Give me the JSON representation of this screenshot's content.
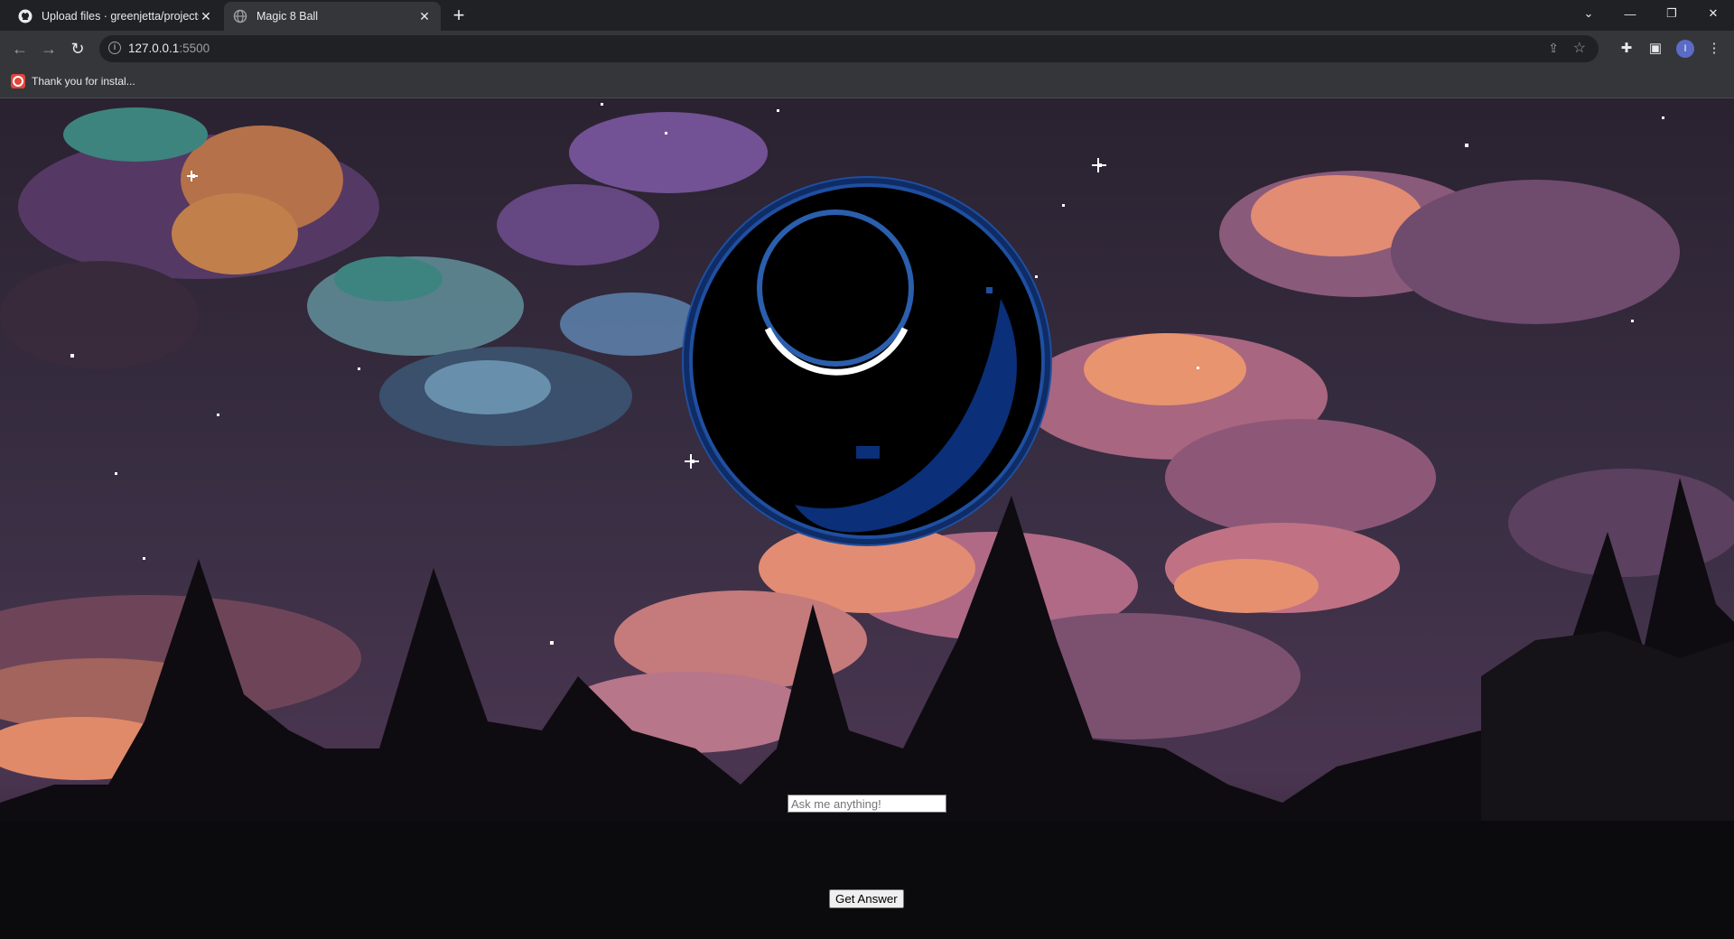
{
  "browser": {
    "tabs": [
      {
        "title": "Upload files · greenjetta/projects",
        "icon": "github-icon",
        "active": false
      },
      {
        "title": "Magic 8 Ball",
        "icon": "globe-icon",
        "active": true
      }
    ],
    "address": {
      "host": "127.0.0.1",
      "port": ":5500"
    },
    "bookmarks": [
      {
        "label": "Thank you for instal...",
        "icon": "extension-bookmark-icon"
      }
    ],
    "profile_initial": "I"
  },
  "page": {
    "question_placeholder": "Ask me anything!",
    "question_value": "",
    "button_label": "Get Answer"
  },
  "colors": {
    "ball_rim": "#1f4fa0",
    "ball_body": "#000000",
    "ball_window_ring": "#2b5fae"
  }
}
